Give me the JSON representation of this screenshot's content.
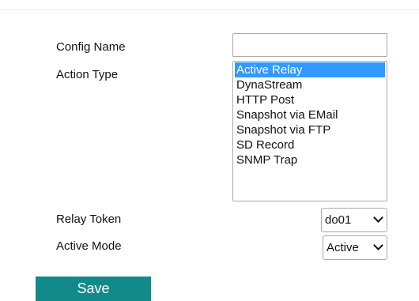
{
  "form": {
    "config_name": {
      "label": "Config Name",
      "value": ""
    },
    "action_type": {
      "label": "Action Type",
      "options": [
        "Active Relay",
        "DynaStream",
        "HTTP Post",
        "Snapshot via EMail",
        "Snapshot via FTP",
        "SD Record",
        "SNMP Trap"
      ],
      "selected": "Active Relay"
    },
    "relay_token": {
      "label": "Relay Token",
      "value": "do01"
    },
    "active_mode": {
      "label": "Active Mode",
      "value": "Active"
    },
    "save_label": "Save"
  },
  "colors": {
    "save_button": "#138a8a",
    "list_selection": "#3399ff"
  },
  "icons": {
    "dropdown": "chevron-down-icon"
  }
}
